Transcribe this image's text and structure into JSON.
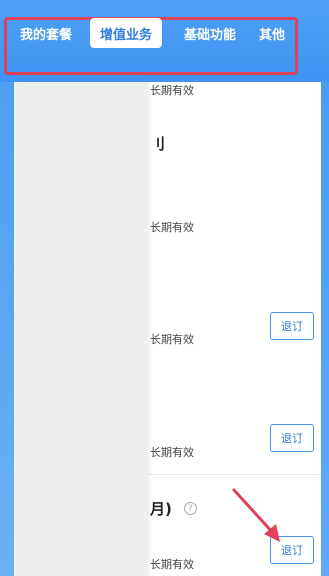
{
  "tabs": [
    {
      "label": "我的套餐",
      "active": false
    },
    {
      "label": "增值业务",
      "active": true
    },
    {
      "label": "基础功能",
      "active": false
    },
    {
      "label": "其他",
      "active": false
    }
  ],
  "items": [
    {
      "validity": "长期有效"
    },
    {
      "title_fragment": "刂",
      "validity": "长期有效"
    },
    {
      "validity": "长期有效",
      "button": "退订"
    },
    {
      "validity": "长期有效",
      "button": "退订"
    },
    {
      "title_fragment": "月)",
      "validity": "长期有效",
      "button": "退订",
      "help": "?"
    }
  ],
  "colors": {
    "header_blue": "#3f93f1",
    "highlight_red": "#e0405a",
    "button_blue": "#2f7fe0"
  }
}
